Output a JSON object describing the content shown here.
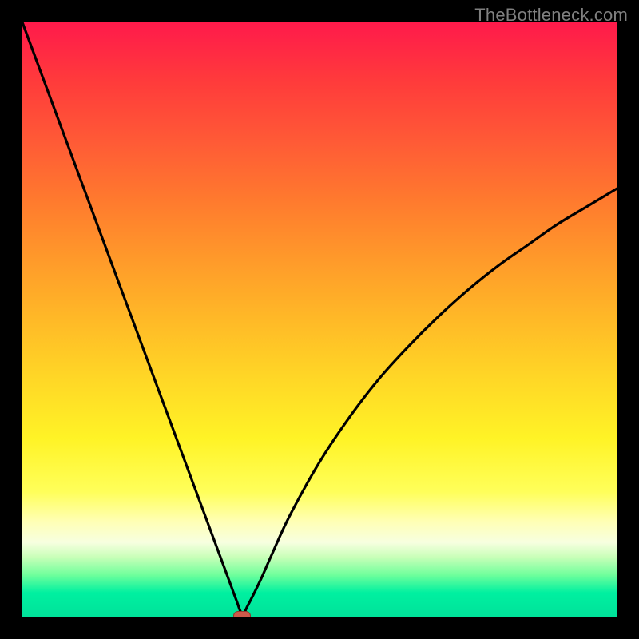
{
  "watermark": "TheBottleneck.com",
  "chart_data": {
    "type": "line",
    "title": "",
    "xlabel": "",
    "ylabel": "",
    "x": [
      0,
      2,
      4,
      6,
      8,
      10,
      12,
      14,
      16,
      18,
      20,
      22,
      24,
      26,
      28,
      30,
      32,
      34,
      35,
      36,
      37,
      38,
      40,
      42,
      45,
      50,
      55,
      60,
      65,
      70,
      75,
      80,
      85,
      90,
      95,
      100
    ],
    "values": [
      100,
      94.6,
      89.2,
      83.8,
      78.4,
      73.0,
      67.6,
      62.2,
      56.8,
      51.4,
      46.0,
      40.6,
      35.2,
      29.8,
      24.4,
      19.0,
      13.6,
      8.2,
      5.5,
      2.8,
      0.5,
      2.0,
      6.0,
      10.5,
      17.0,
      26.0,
      33.5,
      40.0,
      45.5,
      50.5,
      55.0,
      59.0,
      62.5,
      66.0,
      69.0,
      72.0
    ],
    "xlim": [
      0,
      100
    ],
    "ylim": [
      0,
      100
    ],
    "marker": {
      "x": 37,
      "y": 0
    },
    "grid": false,
    "background_gradient": {
      "top": "#ff1a4b",
      "mid": "#ffd726",
      "bottom": "#00e29a"
    }
  }
}
